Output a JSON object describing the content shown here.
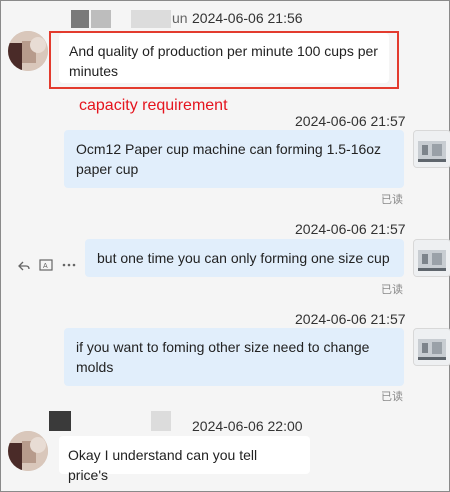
{
  "messages": [
    {
      "direction": "incoming",
      "sender_partial": "un",
      "timestamp": "2024-06-06 21:56",
      "text": "And quality of production per minute 100 cups per minutes"
    },
    {
      "direction": "outgoing",
      "timestamp": "2024-06-06 21:57",
      "text": "Ocm12 Paper cup machine can forming 1.5-16oz paper cup",
      "status": "已读"
    },
    {
      "direction": "outgoing",
      "timestamp": "2024-06-06 21:57",
      "text": "but one time you can only forming one size cup",
      "status": "已读"
    },
    {
      "direction": "outgoing",
      "timestamp": "2024-06-06 21:57",
      "text": "if you want to foming other size need to change molds",
      "status": "已读"
    },
    {
      "direction": "incoming",
      "timestamp": "2024-06-06 22:00",
      "text": "Okay I understand can you tell price's"
    }
  ],
  "annotation": {
    "label": "capacity requirement",
    "color": "#e5141e"
  },
  "message_actions": [
    "reply-icon",
    "translate-icon",
    "more-icon"
  ],
  "colors": {
    "outgoing_bubble": "#e1eefb",
    "incoming_bubble": "#ffffff",
    "background": "#f5f5f5"
  }
}
